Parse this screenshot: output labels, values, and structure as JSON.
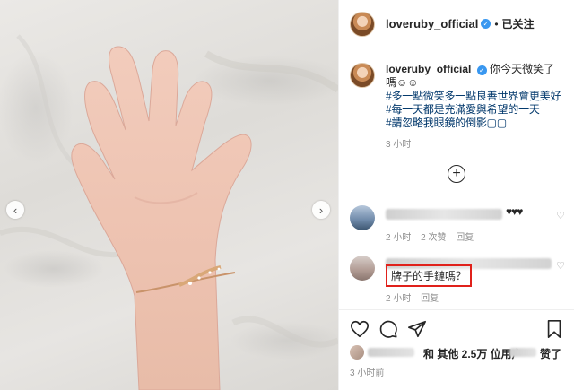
{
  "header": {
    "username": "loveruby_official",
    "separator": "•",
    "follow_status": "已关注"
  },
  "caption": {
    "username": "loveruby_official",
    "text": "你今天微笑了嗎☺☺",
    "hashtags": [
      "#多一點微笑多一點良善世界會更美好",
      "#每一天都是充滿愛與希望的一天",
      "#請忽略我眼鏡的倒影▢▢"
    ],
    "time": "3 小时"
  },
  "comments": [
    {
      "text_visible": "♥♥♥",
      "time": "2 小时",
      "likes": "2 次赞",
      "reply_label": "回复"
    },
    {
      "text": "牌子的手鏈嗎？",
      "time": "2 小时",
      "reply_label": "回复"
    }
  ],
  "likes": {
    "mid": "和 其他 2.5万 位用户",
    "tail": "赞了"
  },
  "post_time": "3 小时前",
  "icons": {
    "verified": "verified-badge-icon",
    "heart": "heart-icon",
    "comment": "comment-icon",
    "share": "share-icon",
    "bookmark": "bookmark-icon",
    "load_more": "plus-circle-icon"
  },
  "colors": {
    "hashtag": "#00376b",
    "verified": "#3897f0",
    "highlight_box": "#e0211b"
  }
}
